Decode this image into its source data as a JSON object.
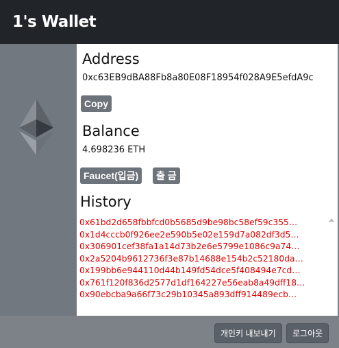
{
  "app": {
    "title": "1's Wallet"
  },
  "account": {
    "address_heading": "Address",
    "address": "0xc63EB9dBA88Fb8a80E08F18954f028A9E5efdA9c",
    "copy_label": "Copy",
    "balance_heading": "Balance",
    "balance": "4.698236 ETH",
    "faucet_label": "Faucet(입금)",
    "withdraw_label": "출 금"
  },
  "history": {
    "heading": "History",
    "items": [
      "0x61bd2d658fbbfcd0b5685d9be98bc58ef59c355…",
      "0x1d4cccb0f926ee2e590b5e02e159d7a082df3d5…",
      "0x306901cef38fa1a14d73b2e6e5799e1086c9a74…",
      "0x2a5204b9612736f3e87b14688e154b2c52180da…",
      "0x199bb6e944110d44b149fd54dce5f408494e7cd…",
      "0x761f120f836d2577d1df164227e56eab8a49dff18…",
      "0x90ebcba9a66f73c29b10345a893dff914489ecb…"
    ]
  },
  "footer": {
    "export_key_label": "개인키 내보내기",
    "logout_label": "로그아웃"
  },
  "colors": {
    "header_bg": "#212529",
    "history_text": "#e00000",
    "button_bg": "#6c737b"
  },
  "icons": {
    "logo": "ethereum-icon"
  }
}
